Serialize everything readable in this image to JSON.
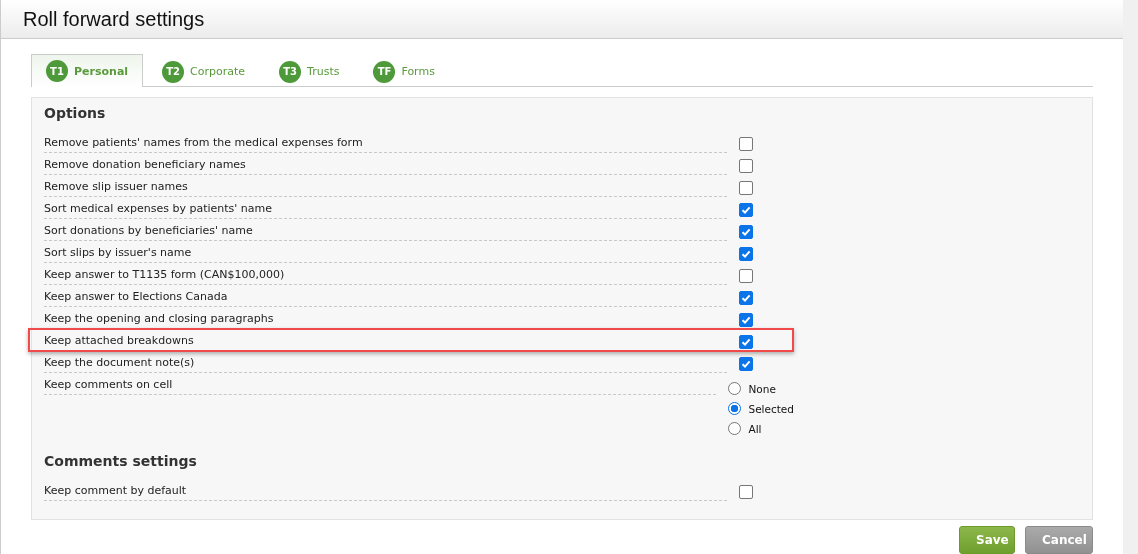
{
  "window": {
    "title": "Roll forward settings"
  },
  "tabs": [
    {
      "badge": "T1",
      "label": "Personal",
      "selected": true
    },
    {
      "badge": "T2",
      "label": "Corporate",
      "selected": false
    },
    {
      "badge": "T3",
      "label": "Trusts",
      "selected": false
    },
    {
      "badge": "TF",
      "label": "Forms",
      "selected": false
    }
  ],
  "sections": [
    {
      "title": "Options",
      "items": [
        {
          "kind": "checkbox",
          "label": "Remove patients' names from the medical expenses form",
          "checked": false,
          "highlighted": false
        },
        {
          "kind": "checkbox",
          "label": "Remove donation beneficiary names",
          "checked": false,
          "highlighted": false
        },
        {
          "kind": "checkbox",
          "label": "Remove slip issuer names",
          "checked": false,
          "highlighted": false
        },
        {
          "kind": "checkbox",
          "label": "Sort medical expenses by patients' name",
          "checked": true,
          "highlighted": false
        },
        {
          "kind": "checkbox",
          "label": "Sort donations by beneficiaries' name",
          "checked": true,
          "highlighted": false
        },
        {
          "kind": "checkbox",
          "label": "Sort slips by issuer's name",
          "checked": true,
          "highlighted": false
        },
        {
          "kind": "checkbox",
          "label": "Keep answer to T1135 form (CAN$100,000)",
          "checked": false,
          "highlighted": false
        },
        {
          "kind": "checkbox",
          "label": "Keep answer to Elections Canada",
          "checked": true,
          "highlighted": false
        },
        {
          "kind": "checkbox",
          "label": "Keep the opening and closing paragraphs",
          "checked": true,
          "highlighted": false
        },
        {
          "kind": "checkbox",
          "label": "Keep attached breakdowns",
          "checked": true,
          "highlighted": true
        },
        {
          "kind": "checkbox",
          "label": "Keep the document note(s)",
          "checked": true,
          "highlighted": false
        },
        {
          "kind": "radio",
          "label": "Keep comments on cell",
          "options": [
            {
              "label": "None",
              "selected": false
            },
            {
              "label": "Selected",
              "selected": true
            },
            {
              "label": "All",
              "selected": false
            }
          ]
        }
      ]
    },
    {
      "title": "Comments settings",
      "items": [
        {
          "kind": "checkbox",
          "label": "Keep comment by default",
          "checked": false,
          "highlighted": false
        }
      ]
    }
  ],
  "buttons": [
    {
      "kind": "primary",
      "label": "Save"
    },
    {
      "kind": "secondary",
      "label": "Cancel"
    }
  ]
}
